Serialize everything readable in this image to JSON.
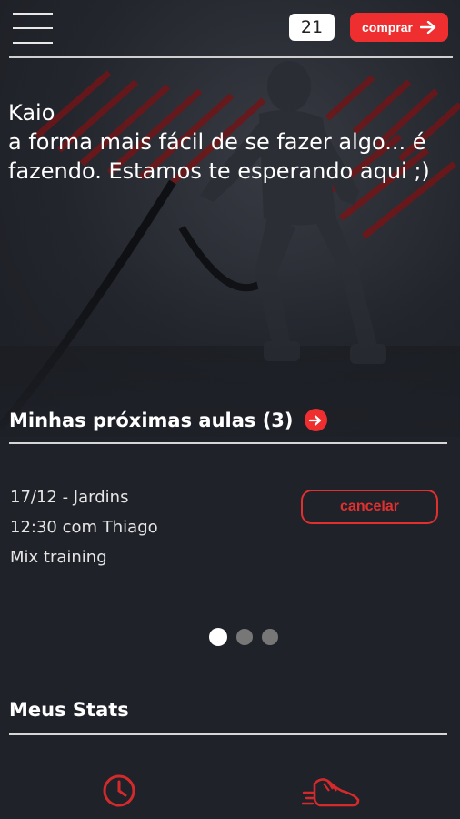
{
  "header": {
    "credits": "21",
    "buy_label": "comprar"
  },
  "hero": {
    "name": "Kaio",
    "message": "a forma mais fácil de se fazer algo... é fazendo. Estamos te esperando aqui ;)"
  },
  "next_classes": {
    "title": "Minhas próximas aulas (3)",
    "items": [
      {
        "date_location": "17/12 - Jardins",
        "time_instructor": "12:30 com Thiago",
        "class_name": "Mix training",
        "cancel_label": "cancelar"
      }
    ],
    "pages": 3,
    "active_page": 1
  },
  "stats": {
    "title": "Meus Stats",
    "icons": [
      "clock-icon",
      "running-shoe-icon"
    ]
  },
  "colors": {
    "accent": "#ee2e2f",
    "background": "#1f2229",
    "divider": "#d6d6d6"
  }
}
